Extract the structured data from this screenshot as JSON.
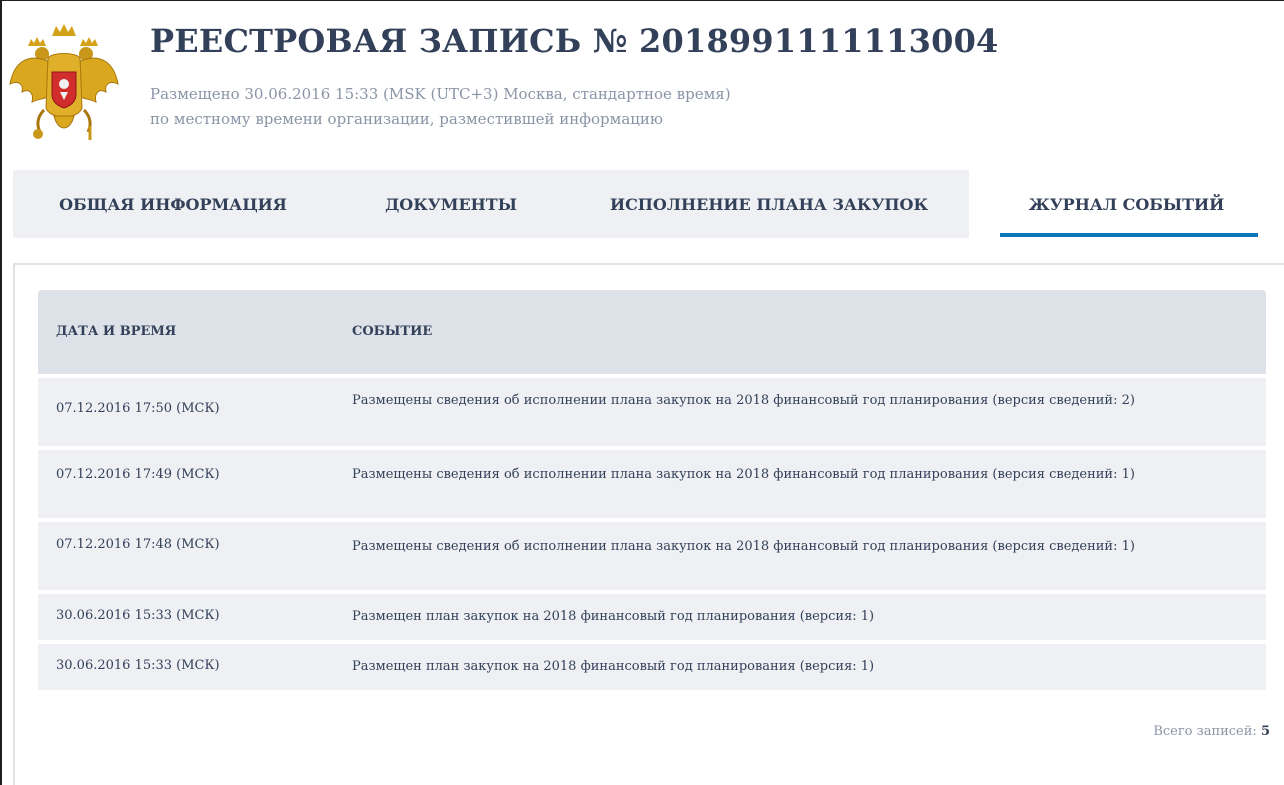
{
  "header": {
    "title": "РЕЕСТРОВАЯ ЗАПИСЬ № 2018991111113004",
    "posted_line1": "Размещено 30.06.2016 15:33 (MSK (UTC+3) Москва, стандартное время)",
    "posted_line2": "по местному времени организации, разместившей информацию"
  },
  "tabs": [
    {
      "label": "ОБЩАЯ ИНФОРМАЦИЯ",
      "active": false
    },
    {
      "label": "ДОКУМЕНТЫ",
      "active": false
    },
    {
      "label": "ИСПОЛНЕНИЕ ПЛАНА ЗАКУПОК",
      "active": false
    },
    {
      "label": "ЖУРНАЛ СОБЫТИЙ",
      "active": true
    }
  ],
  "table": {
    "columns": [
      "ДАТА И ВРЕМЯ",
      "СОБЫТИЕ"
    ],
    "rows": [
      {
        "date": "07.12.2016 17:50 (МСК)",
        "event": "Размещены сведения об исполнении плана закупок на 2018 финансовый год планирования (версия сведений: 2)"
      },
      {
        "date": "07.12.2016 17:49 (МСК)",
        "event": "Размещены сведения об исполнении плана закупок на 2018 финансовый год планирования (версия сведений: 1)"
      },
      {
        "date": "07.12.2016 17:48 (МСК)",
        "event": "Размещены сведения об исполнении плана закупок на 2018 финансовый год планирования (версия сведений: 1)"
      },
      {
        "date": "30.06.2016 15:33 (МСК)",
        "event": "Размещен план закупок на 2018 финансовый год планирования (версия: 1)"
      },
      {
        "date": "30.06.2016 15:33 (МСК)",
        "event": "Размещен план закупок на 2018 финансовый год планирования (версия: 1)"
      }
    ]
  },
  "footer": {
    "total_label": "Всего записей:",
    "total_count": "5"
  },
  "colors": {
    "accent": "#0f75bd",
    "text": "#334059",
    "muted": "#8a94a6",
    "header_bg": "#dde2e8",
    "row_bg": "#eef0f3"
  },
  "icons": {
    "emblem": "russian-coat-of-arms-icon"
  }
}
